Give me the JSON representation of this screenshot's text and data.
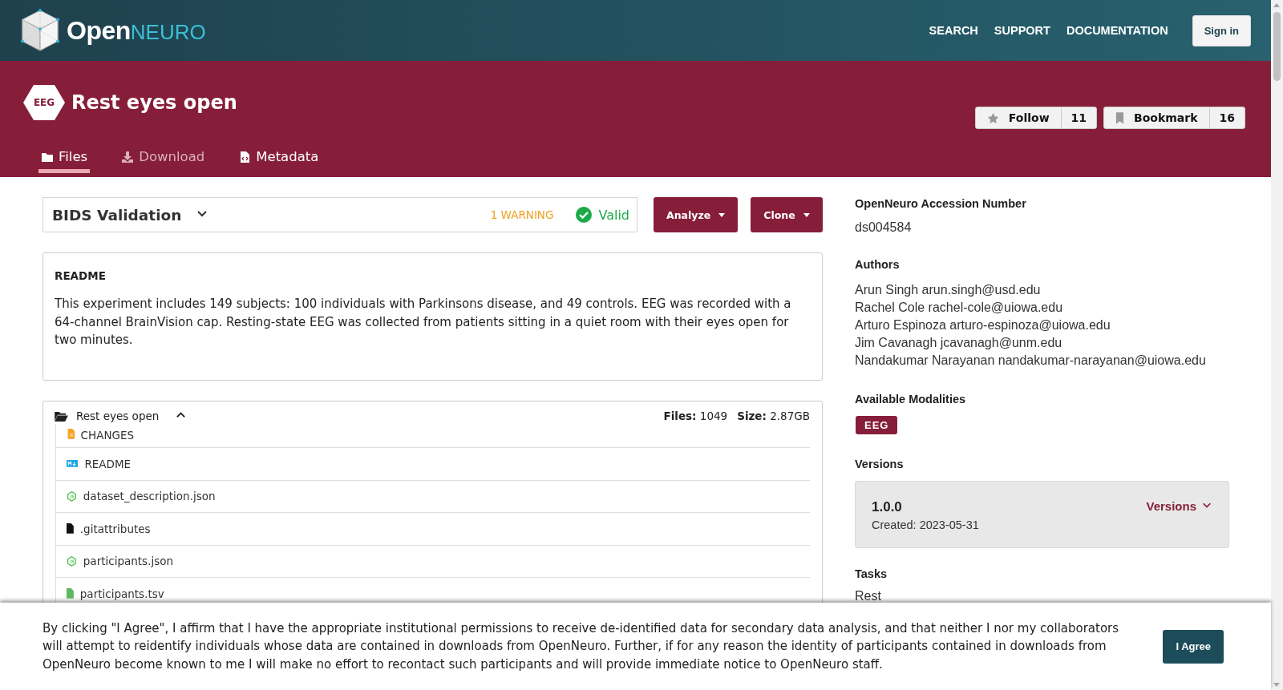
{
  "logo": {
    "text_main": "Open",
    "text_accent": "NEURO"
  },
  "nav": [
    {
      "label": "SEARCH"
    },
    {
      "label": "SUPPORT"
    },
    {
      "label": "DOCUMENTATION"
    }
  ],
  "sign_in": "Sign in",
  "dataset": {
    "modality_badge": "EEG",
    "title": "Rest eyes open",
    "follow": {
      "label": "Follow",
      "count": "11"
    },
    "bookmark": {
      "label": "Bookmark",
      "count": "16"
    }
  },
  "tabs": [
    {
      "label": "Files",
      "kind": "folder",
      "selected": true,
      "disabled": false
    },
    {
      "label": "Download",
      "kind": "download",
      "selected": false,
      "disabled": true
    },
    {
      "label": "Metadata",
      "kind": "code",
      "selected": false,
      "disabled": false
    }
  ],
  "validation": {
    "title": "BIDS Validation",
    "warning": "1 WARNING",
    "status": "Valid"
  },
  "actions": [
    {
      "label": "Analyze"
    },
    {
      "label": "Clone"
    }
  ],
  "readme": {
    "heading": "README",
    "text": "This experiment includes 149 subjects: 100 individuals with Parkinsons disease, and 49 controls. EEG was recorded with a 64-channel BrainVision cap. Resting-state EEG was collected from patients sitting in a quiet room with their eyes open for two minutes."
  },
  "files": {
    "folder": "Rest eyes open",
    "expanded": true,
    "files_count": "**Files:** 1049",
    "size": "**Size:** 2.87GB",
    "items": [
      {
        "name": "CHANGES",
        "kind": "text"
      },
      {
        "name": "README",
        "kind": "markdown"
      },
      {
        "name": "dataset_description.json",
        "kind": "json"
      },
      {
        "name": ".gitattributes",
        "kind": "file"
      },
      {
        "name": "participants.json",
        "kind": "json"
      },
      {
        "name": "participants.tsv",
        "kind": "table"
      }
    ]
  },
  "sidebar": {
    "accession": {
      "heading": "OpenNeuro Accession Number",
      "value": "ds004584"
    },
    "authors": {
      "heading": "Authors",
      "lines": [
        "Arun Singh arun.singh@usd.edu",
        "Rachel Cole rachel-cole@uiowa.edu",
        "Arturo Espinoza arturo-espinoza@uiowa.edu",
        "Jim Cavanagh jcavanagh@unm.edu",
        "Nandakumar Narayanan nandakumar-narayanan@uiowa.edu"
      ]
    },
    "modalities": {
      "heading": "Available Modalities",
      "tags": [
        "EEG"
      ]
    },
    "versions": {
      "heading": "Versions",
      "current": "1.0.0",
      "created": "Created: 2023-05-31",
      "menu": "Versions"
    },
    "tasks": {
      "heading": "Tasks",
      "items": [
        "Rest"
      ]
    }
  },
  "consent": {
    "text": "By clicking \"I Agree\", I affirm that I have the appropriate institutional permissions to receive de-identified data for secondary data analysis, and that neither I nor my collaborators will attempt to reidentify individuals whose data are contained in downloads from OpenNeuro. Further, if for any reason the identity of participants contained in downloads from OpenNeuro become known to me I will make no effort to recontact such participants and will provide immediate notice to OpenNeuro staff.",
    "button": "I Agree"
  }
}
